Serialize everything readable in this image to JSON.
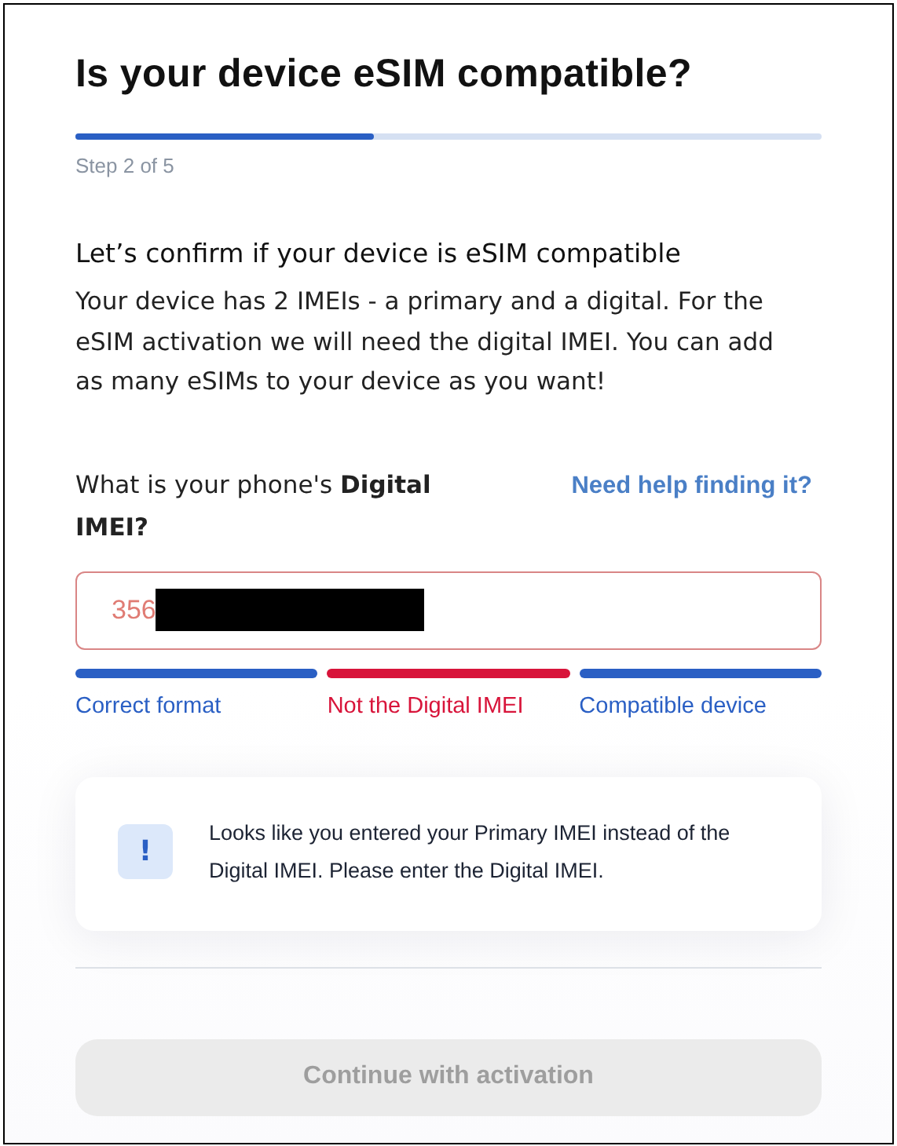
{
  "title": "Is your device eSIM compatible?",
  "progress": {
    "level": 0.4,
    "label": "Step 2 of 5"
  },
  "subheading": "Let’s confirm if your device is eSIM compatible",
  "description": "Your device has 2 IMEIs - a primary and a digital. For the eSIM activation we will need the digital IMEI. You can add as many eSIMs to your device as you want!",
  "question": {
    "label": "What is your phone's **Digital IMEI?**",
    "help_link": "Need help finding it?"
  },
  "imei_field": {
    "value": "356",
    "redacted": true,
    "error": true
  },
  "checks": [
    {
      "label": "Correct format",
      "passed": true
    },
    {
      "label": "Not the Digital IMEI",
      "passed": false
    },
    {
      "label": "Compatible device",
      "passed": true
    }
  ],
  "alert": {
    "icon": "!",
    "message": "Looks like you entered your Primary IMEI instead of the Digital IMEI. Please enter the Digital IMEI."
  },
  "continue_button": {
    "label": "Continue with activation",
    "disabled": true
  }
}
